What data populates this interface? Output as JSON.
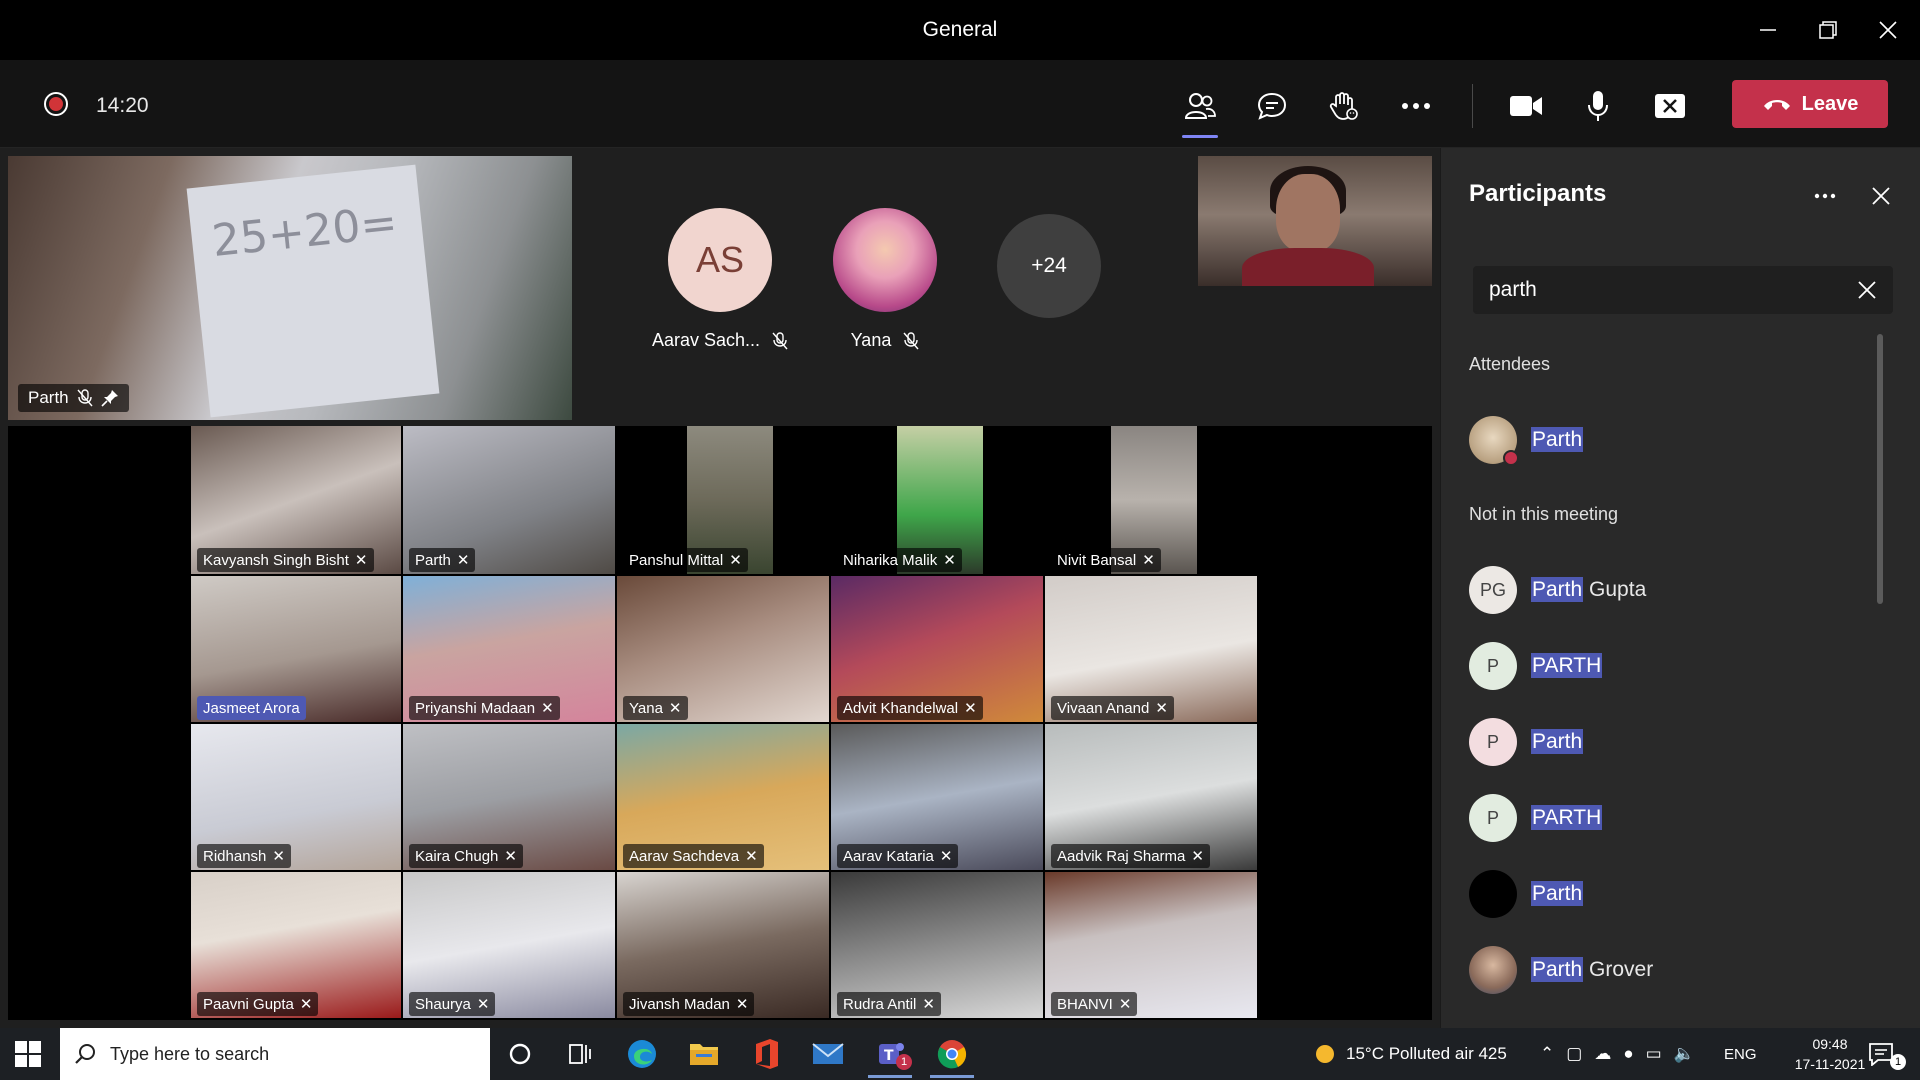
{
  "window": {
    "title": "General"
  },
  "meeting": {
    "timer": "14:20",
    "leave_label": "Leave"
  },
  "pinned": {
    "name": "Parth",
    "paper_text": "25+20="
  },
  "avatars": [
    {
      "initials": "AS",
      "name": "Aarav Sach...",
      "bg": "#f1d5cf",
      "fg": "#7a3f36"
    },
    {
      "initials": "",
      "name": "Yana",
      "bg": "#d96fa5",
      "fg": "#fff"
    },
    {
      "initials": "+24",
      "name": "",
      "bg": "#3f3f3f",
      "fg": "#fff"
    }
  ],
  "gallery": {
    "row1": [
      {
        "name": "Kavyansh Singh Bisht",
        "bg": "linear-gradient(160deg,#6a5a52,#c9c0bb 50%,#5b4a44)"
      },
      {
        "name": "Parth",
        "bg": "linear-gradient(160deg,#bcbcc4,#7f8186 60%,#4f4a45)"
      },
      {
        "name": "Panshul Mittal",
        "bg": "linear-gradient(180deg,#8d8a7e,#6d6a5a 50%,#3a4530)"
      },
      {
        "name": "Niharika Malik",
        "bg": "linear-gradient(180deg,#c5cfa5,#3fa64a 60%,#2c3a2a)"
      },
      {
        "name": "Nivit Bansal",
        "bg": "linear-gradient(180deg,#8a8581,#b8b2ac 50%,#5a5550)"
      }
    ],
    "grid": [
      {
        "name": "Jasmeet Arora",
        "bg": "linear-gradient(170deg,#cfcac5,#a59890 55%,#4a2c2a)",
        "highlight": true
      },
      {
        "name": "Priyanshi Madaan",
        "bg": "linear-gradient(170deg,#7fb0d8,#c9a4a0 45%,#d4849c)"
      },
      {
        "name": "Yana",
        "bg": "linear-gradient(160deg,#6a4a3a,#a88d80 45%,#e2d7d0)"
      },
      {
        "name": "Advit Khandelwal",
        "bg": "linear-gradient(160deg,#5a2a64,#b44a5a 45%,#d08a3a)"
      },
      {
        "name": "Vivaan  Anand",
        "bg": "linear-gradient(170deg,#d2ccc8,#eae6e2 55%,#8a6a5a)"
      },
      {
        "name": "Ridhansh",
        "bg": "linear-gradient(170deg,#e7e8ee,#c9cbd4 60%,#b4a59a)"
      },
      {
        "name": "Kaira Chugh",
        "bg": "linear-gradient(170deg,#bfc0c4,#9c9ea3 50%,#6a4a44)"
      },
      {
        "name": "Aarav Sachdeva",
        "bg": "linear-gradient(170deg,#7ba8a4,#d8a85a 50%,#e5c07a)"
      },
      {
        "name": "Aarav Kataria",
        "bg": "linear-gradient(170deg,#5a5a5a,#aab4c4 50%,#4a4a5a)"
      },
      {
        "name": "Aadvik Raj Sharma",
        "bg": "linear-gradient(170deg,#b8bcbc,#dcdede 50%,#3a3a3a)"
      },
      {
        "name": "Paavni Gupta",
        "bg": "linear-gradient(170deg,#d8d0c8,#e8e0d8 40%,#9a1a1a)"
      },
      {
        "name": "Shaurya",
        "bg": "linear-gradient(170deg,#c8c8c8,#e8e8ec 50%,#8a8aa0)"
      },
      {
        "name": "Jivansh Madan",
        "bg": "linear-gradient(170deg,#d8d4d0,#7a6a60 50%,#3a2a24)"
      },
      {
        "name": "Rudra Antil",
        "bg": "linear-gradient(170deg,#3a3a3a,#8a8a8a 50%,#d8d8d8)"
      },
      {
        "name": "BHANVI",
        "bg": "linear-gradient(170deg,#6a3a2a,#c8c0c0 40%,#e8e8f0)"
      }
    ]
  },
  "panel": {
    "title": "Participants",
    "search_value": "parth",
    "attendees_label": "Attendees",
    "not_in_meeting_label": "Not in this meeting",
    "attendees": [
      {
        "match": "Parth",
        "rest": "",
        "initials": "",
        "avatar_bg": "#c8b8a0",
        "in_call": true
      }
    ],
    "not_in_meeting": [
      {
        "match": "Parth",
        "rest": " Gupta",
        "initials": "PG",
        "avatar_bg": "#ece8e4"
      },
      {
        "match": "PARTH",
        "rest": "",
        "initials": "P",
        "avatar_bg": "#e2ece0"
      },
      {
        "match": "Parth",
        "rest": "",
        "initials": "P",
        "avatar_bg": "#f3dde0"
      },
      {
        "match": "PARTH",
        "rest": "",
        "initials": "P",
        "avatar_bg": "#e2ece0"
      },
      {
        "match": "Parth",
        "rest": "",
        "initials": "",
        "avatar_bg": "#000000"
      },
      {
        "match": "Parth",
        "rest": " Grover",
        "initials": "",
        "avatar_bg": "#8a6a5a"
      }
    ]
  },
  "taskbar": {
    "search_placeholder": "Type here to search",
    "weather": "15°C  Polluted air 425",
    "language": "ENG",
    "time": "09:48",
    "date": "17-11-2021",
    "teams_badge": "1",
    "notif_badge": "1"
  },
  "colors": {
    "leave": "#c4314b",
    "accent": "#7f85f5",
    "highlight": "#4e59b3",
    "recording": "#d13438"
  }
}
